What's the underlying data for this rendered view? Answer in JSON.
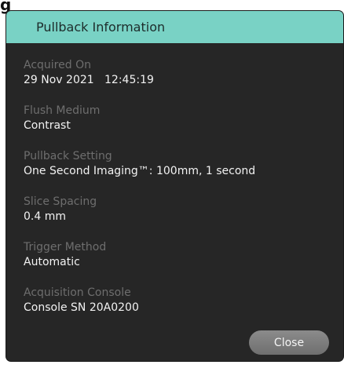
{
  "corner_fragment": "g",
  "dialog": {
    "title": "Pullback Information",
    "fields": [
      {
        "label": "Acquired On",
        "value": "29 Nov 2021   12:45:19"
      },
      {
        "label": "Flush Medium",
        "value": "Contrast"
      },
      {
        "label": "Pullback Setting",
        "value": "One Second Imaging™: 100mm, 1 second"
      },
      {
        "label": "Slice Spacing",
        "value": "0.4 mm"
      },
      {
        "label": "Trigger Method",
        "value": "Automatic"
      },
      {
        "label": "Acquisition Console",
        "value": "Console SN 20A0200"
      }
    ],
    "close_label": "Close"
  },
  "colors": {
    "header_accent": "#79d2c5",
    "dialog_background": "#262626",
    "label_text": "#6e6e6e",
    "value_text": "#f2f2f2",
    "button_background": "#7c7c7c"
  }
}
